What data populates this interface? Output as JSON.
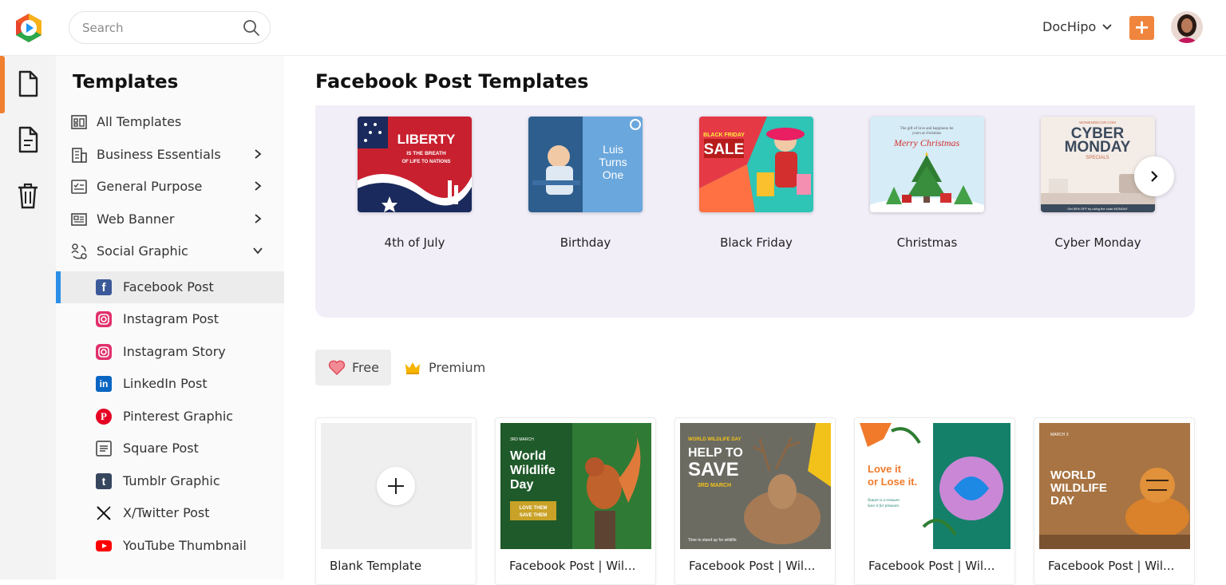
{
  "header": {
    "search_placeholder": "Search",
    "account_name": "DocHipo",
    "add_label": "+"
  },
  "colors": {
    "accent": "#f0853d",
    "active_blue": "#2b8fe8",
    "carousel_bg": "#f2eef8"
  },
  "rail": {
    "items": [
      "document-icon",
      "file-text-icon",
      "trash-icon"
    ]
  },
  "sidebar": {
    "title": "Templates",
    "items": [
      {
        "label": "All Templates",
        "icon": "grid-icon"
      },
      {
        "label": "Business Essentials",
        "icon": "building-icon"
      },
      {
        "label": "General Purpose",
        "icon": "checklist-icon"
      },
      {
        "label": "Web Banner",
        "icon": "banner-icon"
      },
      {
        "label": "Social Graphic",
        "icon": "share-icon"
      }
    ],
    "sub_items": [
      {
        "label": "Facebook Post",
        "icon": "facebook-icon",
        "active": true
      },
      {
        "label": "Instagram Post",
        "icon": "instagram-icon"
      },
      {
        "label": "Instagram Story",
        "icon": "instagram-icon"
      },
      {
        "label": "LinkedIn Post",
        "icon": "linkedin-icon"
      },
      {
        "label": "Pinterest Graphic",
        "icon": "pinterest-icon"
      },
      {
        "label": "Square Post",
        "icon": "square-post-icon"
      },
      {
        "label": "Tumblr Graphic",
        "icon": "tumblr-icon"
      },
      {
        "label": "X/Twitter Post",
        "icon": "x-icon"
      },
      {
        "label": "YouTube Thumbnail",
        "icon": "youtube-icon"
      }
    ]
  },
  "main": {
    "title": "Facebook Post Templates",
    "categories": [
      {
        "label": "4th of July",
        "thumb_text": "LIBERTY",
        "thumb_sub": "IS THE BREATH OF LIFE TO NATIONS"
      },
      {
        "label": "Birthday",
        "thumb_text": "Luis Turns One"
      },
      {
        "label": "Black Friday",
        "thumb_text": "SALE",
        "thumb_sub": "BLACK FRIDAY"
      },
      {
        "label": "Christmas",
        "thumb_text": "Merry Christmas"
      },
      {
        "label": "Cyber Monday",
        "thumb_text": "CYBER MONDAY",
        "thumb_sub": "SPECIALS"
      }
    ],
    "filters": {
      "free": "Free",
      "premium": "Premium"
    },
    "templates": [
      {
        "label": "Blank Template"
      },
      {
        "label": "Facebook Post | Wil...",
        "thumb_text": "World Wildlife Day",
        "thumb_sub": "LOVE THEM SAVE THEM"
      },
      {
        "label": "Facebook Post | Wil...",
        "thumb_text": "HELP TO SAVE",
        "thumb_sub": "3RD MARCH"
      },
      {
        "label": "Facebook Post | Wil...",
        "thumb_text": "Love it or Lose it."
      },
      {
        "label": "Facebook Post | Wil...",
        "thumb_text": "WORLD WILDLIFE DAY"
      }
    ]
  }
}
